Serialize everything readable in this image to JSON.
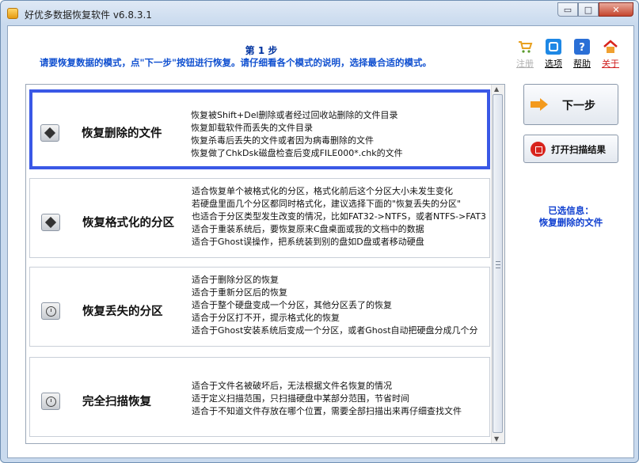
{
  "window": {
    "title": "好优多数据恢复软件  v6.8.3.1",
    "controls": {
      "minimize": "▭",
      "maximize": "□",
      "close": "✕"
    }
  },
  "header": {
    "step_title": "第 1 步",
    "step_desc": "请要恢复数据的模式，点\"下一步\"按钮进行恢复。请仔细看各个模式的说明，选择最合适的模式。"
  },
  "toolbar": [
    {
      "label": "注册",
      "icon": "cart-icon",
      "color": "#b0b0b0"
    },
    {
      "label": "选项",
      "icon": "options-icon",
      "color": "#111111"
    },
    {
      "label": "帮助",
      "icon": "help-icon",
      "color": "#111111"
    },
    {
      "label": "关于",
      "icon": "home-icon",
      "color": "#d02020"
    }
  ],
  "modes": [
    {
      "title": "恢复删除的文件",
      "icon": "diamond-disk-icon",
      "selected": true,
      "lines": [
        "恢复被Shift+Del删除或者经过回收站删除的文件目录",
        "恢复卸载软件而丢失的文件目录",
        "恢复杀毒后丢失的文件或者因为病毒删除的文件",
        "恢复做了ChkDsk磁盘检查后变成FILE000*.chk的文件"
      ]
    },
    {
      "title": "恢复格式化的分区",
      "icon": "diamond-disk-icon",
      "selected": false,
      "lines": [
        "适合恢复单个被格式化的分区，格式化前后这个分区大小未发生变化",
        "若硬盘里面几个分区都同时格式化，建议选择下面的\"恢复丢失的分区\"",
        "也适合于分区类型发生改变的情况，比如FAT32->NTFS，或者NTFS->FAT3",
        "适合于重装系统后，要恢复原来C盘桌面或我的文档中的数据",
        "适合于Ghost误操作，把系统装到别的盘如D盘或者移动硬盘"
      ]
    },
    {
      "title": "恢复丢失的分区",
      "icon": "clock-disk-icon",
      "selected": false,
      "lines": [
        "适合于删除分区的恢复",
        "适合于重新分区后的恢复",
        "适合于整个硬盘变成一个分区，其他分区丢了的恢复",
        "适合于分区打不开，提示格式化的恢复",
        "适合于Ghost安装系统后变成一个分区，或者Ghost自动把硬盘分成几个分"
      ]
    },
    {
      "title": "完全扫描恢复",
      "icon": "clock-disk-icon",
      "selected": false,
      "lines": [
        "适合于文件名被破坏后，无法根据文件名恢复的情况",
        "适于定义扫描范围，只扫描硬盘中某部分范围，节省时间",
        "适合于不知道文件存放在哪个位置，需要全部扫描出来再仔细查找文件"
      ]
    }
  ],
  "buttons": {
    "next": "下一步",
    "open_scan": "打开扫描结果"
  },
  "selected_info": {
    "label": "已选信息：",
    "value": "恢复删除的文件"
  },
  "colors": {
    "accent": "#3a58e6",
    "title_blue": "#0033a0",
    "desc_blue": "#1050d0"
  }
}
